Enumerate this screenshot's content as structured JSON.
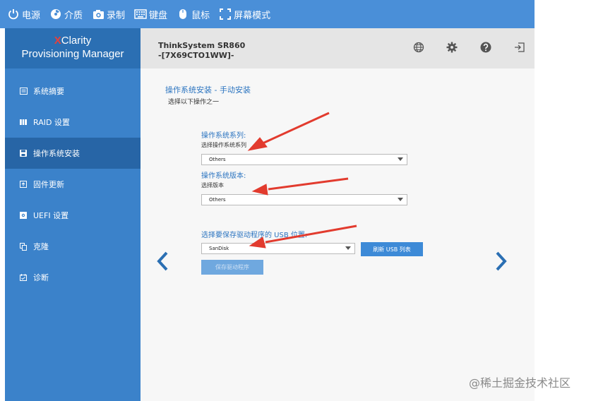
{
  "toolbar": {
    "power_label": "电源",
    "media_label": "介质",
    "record_label": "录制",
    "keyboard_label": "键盘",
    "mouse_label": "鼠标",
    "fullscreen_label": "屏幕模式"
  },
  "brand": {
    "x_letter": "X",
    "clarity": "Clarity",
    "product": "Provisioning Manager"
  },
  "header": {
    "server_name": "ThinkSystem SR860",
    "server_id": "-[7X69CTO1WW]-"
  },
  "sidebar": {
    "items": [
      {
        "label": "系统摘要",
        "icon": "summary-icon"
      },
      {
        "label": "RAID 设置",
        "icon": "raid-icon"
      },
      {
        "label": "操作系统安装",
        "icon": "disk-icon"
      },
      {
        "label": "固件更新",
        "icon": "firmware-icon"
      },
      {
        "label": "UEFI 设置",
        "icon": "uefi-icon"
      },
      {
        "label": "克隆",
        "icon": "clone-icon"
      },
      {
        "label": "诊断",
        "icon": "diagnostics-icon"
      }
    ],
    "active_index": 2
  },
  "main": {
    "title": "操作系统安装 - 手动安装",
    "subtitle": "选择以下操作之一",
    "os_family": {
      "heading": "操作系统系列:",
      "label": "选择操作系统系列",
      "value": "Others"
    },
    "os_version": {
      "heading": "操作系统版本:",
      "label": "选择版本",
      "value": "Others"
    },
    "usb": {
      "heading": "选择要保存驱动程序的 USB 位置:",
      "value": "SanDisk",
      "refresh_label": "刷新 USB 列表",
      "save_label": "保存驱动程序"
    }
  },
  "colors": {
    "topbar": "#4a8fd8",
    "sidebar": "#3b82ca",
    "sidebar_active": "#2765a6",
    "accent": "#2b74c0",
    "annotation_arrow": "#e23b2e"
  },
  "watermark": "@稀土掘金技术社区"
}
